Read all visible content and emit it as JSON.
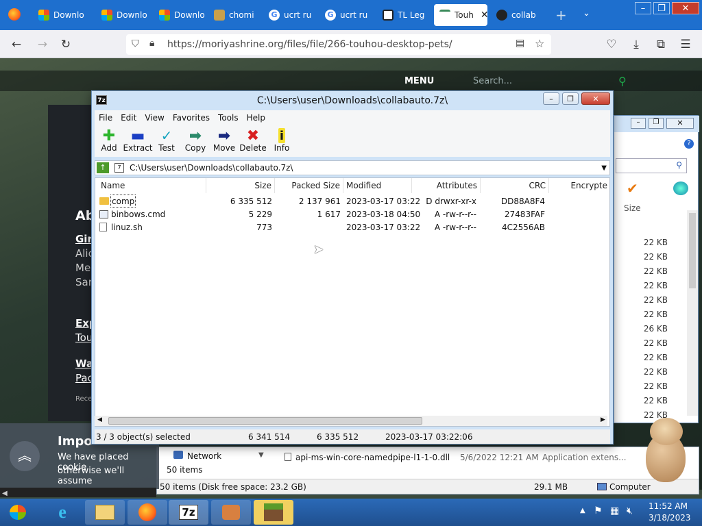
{
  "browser": {
    "tabs": [
      {
        "label": "Downlo",
        "active": false
      },
      {
        "label": "Downlo",
        "active": false
      },
      {
        "label": "Downlo",
        "active": false
      },
      {
        "label": "chomi",
        "active": false
      },
      {
        "label": "ucrt ru",
        "active": false
      },
      {
        "label": "ucrt ru",
        "active": false
      },
      {
        "label": "TL Leg",
        "active": false
      },
      {
        "label": "Touh",
        "active": true
      },
      {
        "label": "collab",
        "active": false
      }
    ],
    "url": "https://moriyashrine.org/files/file/266-touhou-desktop-pets/",
    "site_menu": "MENU",
    "site_search": "Search...",
    "site_texts": [
      "Ab",
      "Gir",
      "Alic",
      "Me",
      "Sar",
      "Exp",
      "Tou",
      "Wa",
      "Pac",
      "Rece"
    ]
  },
  "zip": {
    "title": "C:\\Users\\user\\Downloads\\collabauto.7z\\",
    "icon_label": "7z",
    "menu": [
      "File",
      "Edit",
      "View",
      "Favorites",
      "Tools",
      "Help"
    ],
    "toolbar": [
      {
        "label": "Add",
        "icon": "plus-icon",
        "color": "#2db52d"
      },
      {
        "label": "Extract",
        "icon": "minus-icon",
        "color": "#1b3fc4"
      },
      {
        "label": "Test",
        "icon": "check-icon",
        "color": "#19a6c0"
      },
      {
        "label": "Copy",
        "icon": "copy-arrow-icon",
        "color": "#2b8a6a"
      },
      {
        "label": "Move",
        "icon": "move-arrow-icon",
        "color": "#1a2a80"
      },
      {
        "label": "Delete",
        "icon": "x-icon",
        "color": "#d82020"
      },
      {
        "label": "Info",
        "icon": "info-icon",
        "color": "#1a1a1a"
      }
    ],
    "address": "C:\\Users\\user\\Downloads\\collabauto.7z\\",
    "columns": [
      "Name",
      "Size",
      "Packed Size",
      "Modified",
      "Attributes",
      "CRC",
      "Encrypte"
    ],
    "rows": [
      {
        "name": "comp",
        "type": "folder",
        "size": "6 335 512",
        "packed": "2 137 961",
        "modified": "2023-03-17 03:22",
        "attributes": "D drwxr-xr-x",
        "crc": "DD88A8F4"
      },
      {
        "name": "binbows.cmd",
        "type": "cmd",
        "size": "5 229",
        "packed": "1 617",
        "modified": "2023-03-18 04:50",
        "attributes": "A -rw-r--r--",
        "crc": "27483FAF"
      },
      {
        "name": "linuz.sh",
        "type": "file",
        "size": "773",
        "packed": "",
        "modified": "2023-03-17 03:22",
        "attributes": "A -rw-r--r--",
        "crc": "4C2556AB"
      }
    ],
    "status": {
      "selected": "3 / 3 object(s) selected",
      "size": "6 341 514",
      "packed": "6 335 512",
      "modified": "2023-03-17 03:22:06"
    }
  },
  "explorer": {
    "size_header": "Size",
    "sizes": [
      "22 KB",
      "22 KB",
      "22 KB",
      "22 KB",
      "22 KB",
      "22 KB",
      "26 KB",
      "22 KB",
      "22 KB",
      "22 KB",
      "22 KB",
      "22 KB",
      "22 KB"
    ],
    "nav_item": "Network",
    "items_count": "50 items",
    "file_name": "api-ms-win-core-namedpipe-l1-1-0.dll",
    "file_date": "5/6/2022 12:21 AM",
    "file_type": "Application extens...",
    "status_left": "50 items (Disk free space: 23.2 GB)",
    "status_size": "29.1 MB",
    "status_location": "Computer"
  },
  "cookie": {
    "title": "Impo",
    "line1": "We have placed cookie",
    "line2": "otherwise we'll assume"
  },
  "taskbar": {
    "time": "11:52 AM",
    "date": "3/18/2023",
    "items": [
      "ie-icon",
      "explorer-icon",
      "firefox-icon",
      "7zip-icon",
      "app-icon",
      "minecraft-icon"
    ],
    "app_label": "7z"
  }
}
